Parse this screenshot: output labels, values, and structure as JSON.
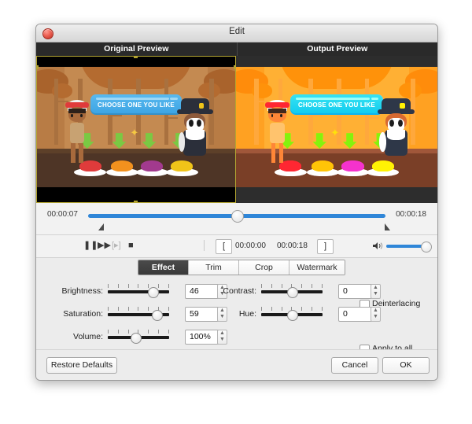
{
  "window": {
    "title": "Edit",
    "close_icon": "close-icon"
  },
  "previews": {
    "original_label": "Original Preview",
    "output_label": "Output Preview",
    "scene": {
      "banner_text": "CHOOSE ONE YOU LIKE",
      "sparkle": "✦"
    }
  },
  "timeline": {
    "start_time": "00:00:07",
    "end_time": "00:00:18",
    "playhead_percent": 50
  },
  "transport": {
    "pause_icon": "❚❚",
    "forward_icon": "▶▶",
    "frame_icon": "[▸]",
    "stop_icon": "■",
    "mark_in_icon": "[",
    "mark_out_icon": "]",
    "time_in": "00:00:00",
    "time_out": "00:00:18",
    "speaker_icon": "🔊",
    "volume_percent": 100
  },
  "tabs": [
    {
      "label": "Effect",
      "active": true
    },
    {
      "label": "Trim",
      "active": false
    },
    {
      "label": "Crop",
      "active": false
    },
    {
      "label": "Watermark",
      "active": false
    }
  ],
  "effect": {
    "brightness": {
      "label": "Brightness:",
      "value": "46",
      "percent": 73
    },
    "saturation": {
      "label": "Saturation:",
      "value": "59",
      "percent": 79
    },
    "volume": {
      "label": "Volume:",
      "value": "100%",
      "percent": 45
    },
    "contrast": {
      "label": "Contrast:",
      "value": "0",
      "percent": 50
    },
    "hue": {
      "label": "Hue:",
      "value": "0",
      "percent": 50
    },
    "deinterlacing": {
      "label": "Deinterlacing",
      "checked": false
    },
    "apply_to_all": {
      "label": "Apply to all",
      "checked": false
    }
  },
  "footer": {
    "restore_label": "Restore Defaults",
    "cancel_label": "Cancel",
    "ok_label": "OK"
  },
  "colors": {
    "accent_blue": "#2f86d8",
    "selection_yellow": "#b3a531",
    "tab_active_bg": "#3a3a3a"
  }
}
